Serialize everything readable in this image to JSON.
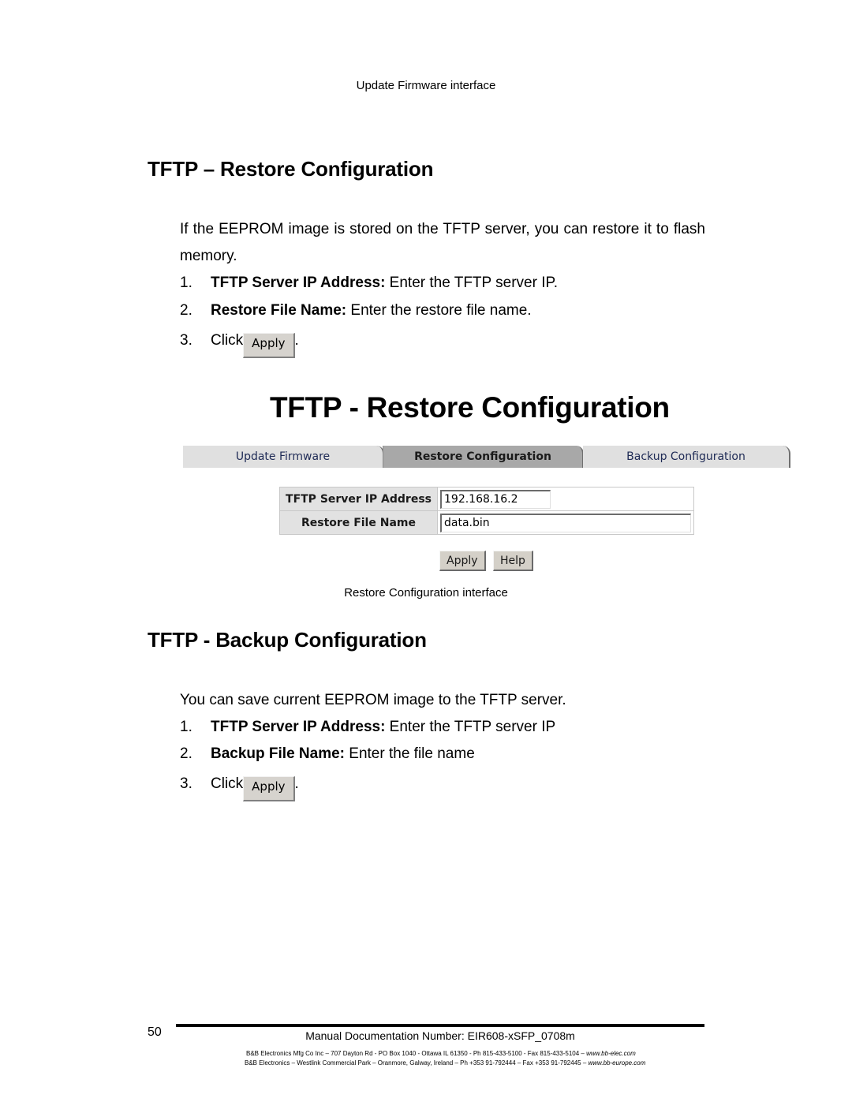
{
  "captions": {
    "update_firmware": "Update Firmware interface",
    "restore_config": "Restore Configuration interface"
  },
  "restore_section": {
    "heading": "TFTP – Restore Configuration",
    "intro": "If the EEPROM image is stored on the TFTP server, you can restore it to flash memory.",
    "steps": [
      {
        "num": "1.",
        "bold": "TFTP Server IP Address:",
        "text": " Enter the TFTP server IP."
      },
      {
        "num": "2.",
        "bold": "Restore File Name:",
        "text": " Enter the restore file name."
      },
      {
        "num": "3.",
        "click": "Click",
        "button": "Apply",
        "tail": "."
      }
    ]
  },
  "screenshot": {
    "title": "TFTP - Restore Configuration",
    "tabs": [
      {
        "label": "Update Firmware",
        "active": false
      },
      {
        "label": "Restore Configuration",
        "active": true
      },
      {
        "label": "Backup Configuration",
        "active": false
      }
    ],
    "form": {
      "ip_label": "TFTP Server IP Address",
      "ip_value": "192.168.16.2",
      "file_label": "Restore File Name",
      "file_value": "data.bin"
    },
    "buttons": {
      "apply": "Apply",
      "help": "Help"
    }
  },
  "backup_section": {
    "heading": "TFTP - Backup Configuration",
    "intro": "You can save current EEPROM image to the TFTP server.",
    "steps": [
      {
        "num": "1.",
        "bold": "TFTP Server IP Address:",
        "text": " Enter the TFTP server IP"
      },
      {
        "num": "2.",
        "bold": "Backup File Name:",
        "text": " Enter the file name"
      },
      {
        "num": "3.",
        "click": "Click",
        "button": "Apply",
        "tail": "."
      }
    ]
  },
  "footer": {
    "page_number": "50",
    "doc_number": "Manual Documentation Number: EIR608-xSFP_0708m",
    "us_address": "B&B Electronics Mfg Co Inc – 707 Dayton Rd - PO Box 1040 - Ottawa IL 61350 - Ph 815-433-5100 - Fax 815-433-5104 – ",
    "us_web": "www.bb-elec.com",
    "eu_address": "B&B Electronics – Westlink Commercial Park – Oranmore, Galway, Ireland – Ph +353 91-792444 – Fax +353 91-792445 – ",
    "eu_web": "www.bb-europe.com"
  }
}
